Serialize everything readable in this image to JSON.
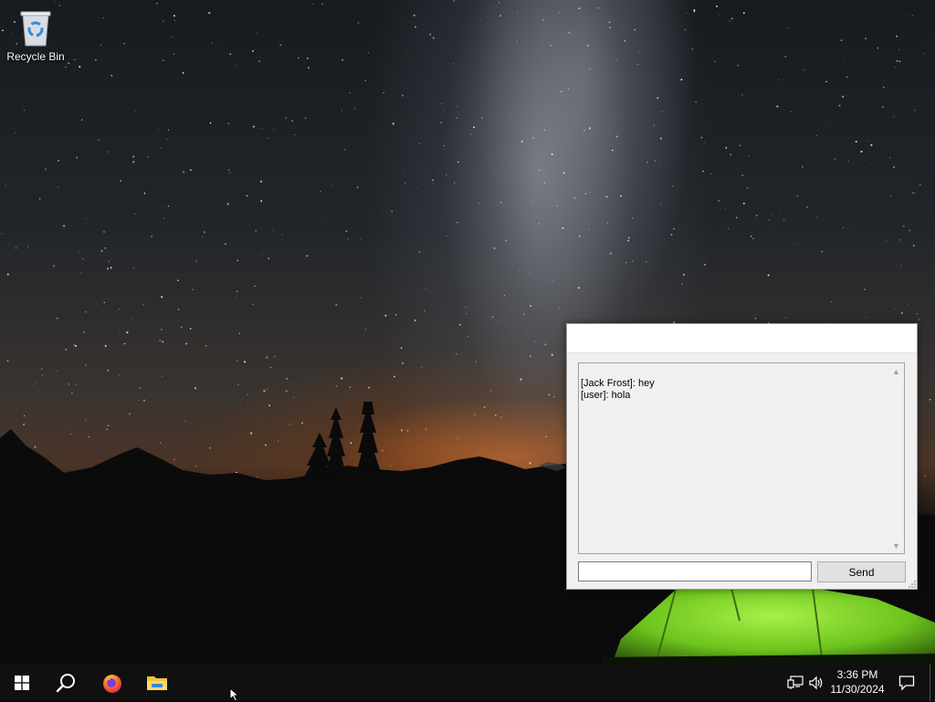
{
  "desktop": {
    "icons": [
      {
        "label": "Recycle Bin",
        "icon": "recycle-bin-icon"
      }
    ]
  },
  "chat_window": {
    "title": "",
    "messages": [
      "[Jack Frost]: hey",
      "[user]: hola"
    ],
    "input_value": "",
    "send_label": "Send"
  },
  "taskbar": {
    "pinned": [
      {
        "name": "start",
        "icon": "windows-logo-icon"
      },
      {
        "name": "search",
        "icon": "search-icon"
      },
      {
        "name": "firefox",
        "icon": "firefox-icon"
      },
      {
        "name": "file-explorer",
        "icon": "folder-icon"
      }
    ],
    "tray": {
      "time": "3:36 PM",
      "date": "11/30/2024",
      "icons": [
        "network-icon",
        "volume-icon",
        "notification-icon"
      ]
    }
  },
  "colors": {
    "taskbar_bg": "#101010",
    "window_bg": "#f0f0f0",
    "accent_green_tent": "#7ed321"
  }
}
